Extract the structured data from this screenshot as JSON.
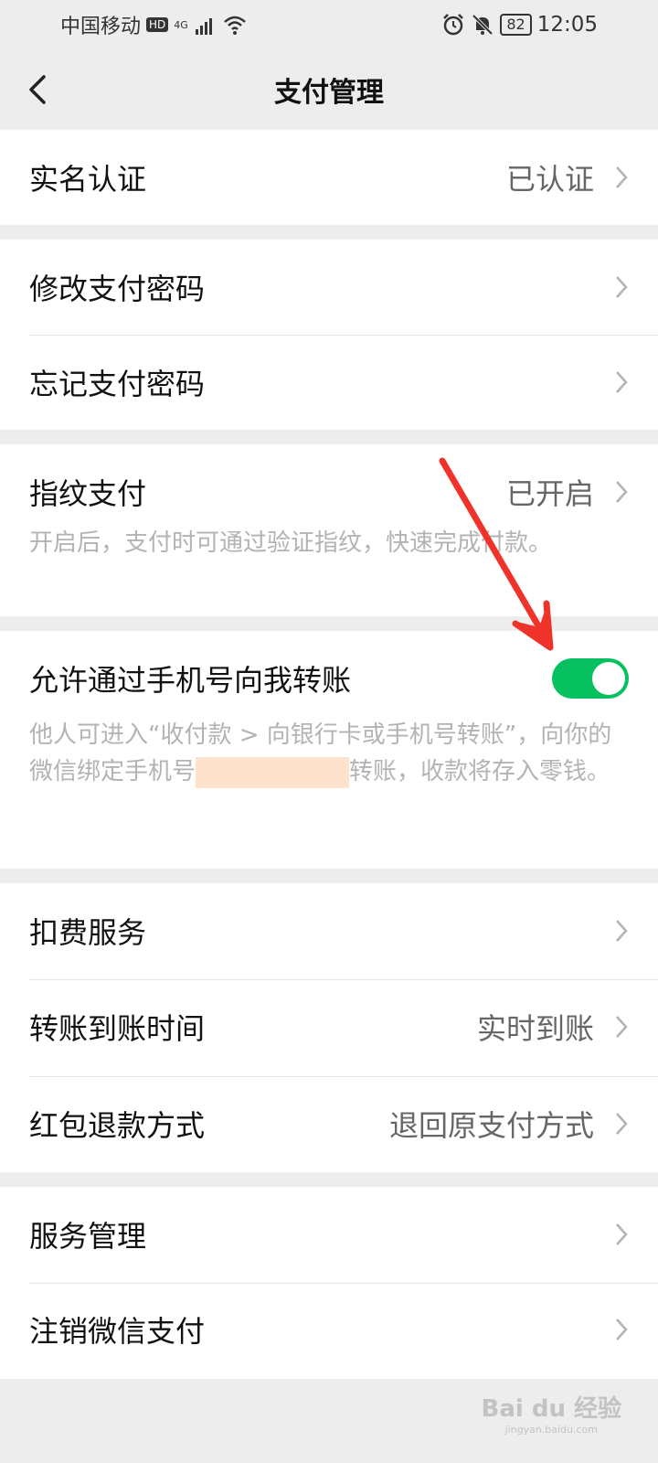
{
  "status_bar": {
    "carrier": "中国移动",
    "hd": "HD",
    "network": "4G",
    "battery": "82",
    "time": "12:05"
  },
  "nav": {
    "title": "支付管理"
  },
  "rows": {
    "real_name": {
      "label": "实名认证",
      "value": "已认证"
    },
    "change_password": {
      "label": "修改支付密码"
    },
    "forgot_password": {
      "label": "忘记支付密码"
    },
    "fingerprint": {
      "label": "指纹支付",
      "value": "已开启",
      "desc": "开启后，支付时可通过验证指纹，快速完成付款。"
    },
    "phone_transfer": {
      "label": "允许通过手机号向我转账",
      "toggle_on": true,
      "desc_part1": "他人可进入“收付款 > 向银行卡或手机号转账”，向你的微信绑定手机号",
      "desc_part2": "转账，收款将存入零钱。"
    },
    "deduction": {
      "label": "扣费服务"
    },
    "transfer_time": {
      "label": "转账到账时间",
      "value": "实时到账"
    },
    "red_packet_refund": {
      "label": "红包退款方式",
      "value": "退回原支付方式"
    },
    "service_mgmt": {
      "label": "服务管理"
    },
    "cancel_wechat_pay": {
      "label": "注销微信支付"
    }
  },
  "watermark": {
    "text": "Bai du 经验",
    "sub": "jingyan.baidu.com"
  },
  "colors": {
    "accent": "#07c160",
    "annotation_arrow": "#f0332a",
    "mask": "#fde3cd"
  }
}
